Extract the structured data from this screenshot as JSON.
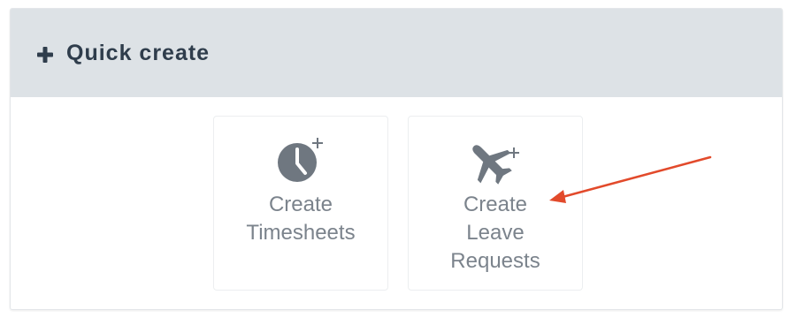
{
  "quick_create": {
    "title": "Quick create",
    "header_icon": "plus-icon",
    "tiles": [
      {
        "icon": "clock-plus-icon",
        "label_lines": [
          "Create",
          "Timesheets"
        ]
      },
      {
        "icon": "airplane-plus-icon",
        "label_lines": [
          "Create",
          "Leave",
          "Requests"
        ]
      }
    ]
  },
  "colors": {
    "header_background": "#dde2e6",
    "header_text": "#2f3d4c",
    "icon_gray": "#6f7780",
    "label_gray": "#7b838c",
    "annotation_arrow": "#e24a2b"
  }
}
